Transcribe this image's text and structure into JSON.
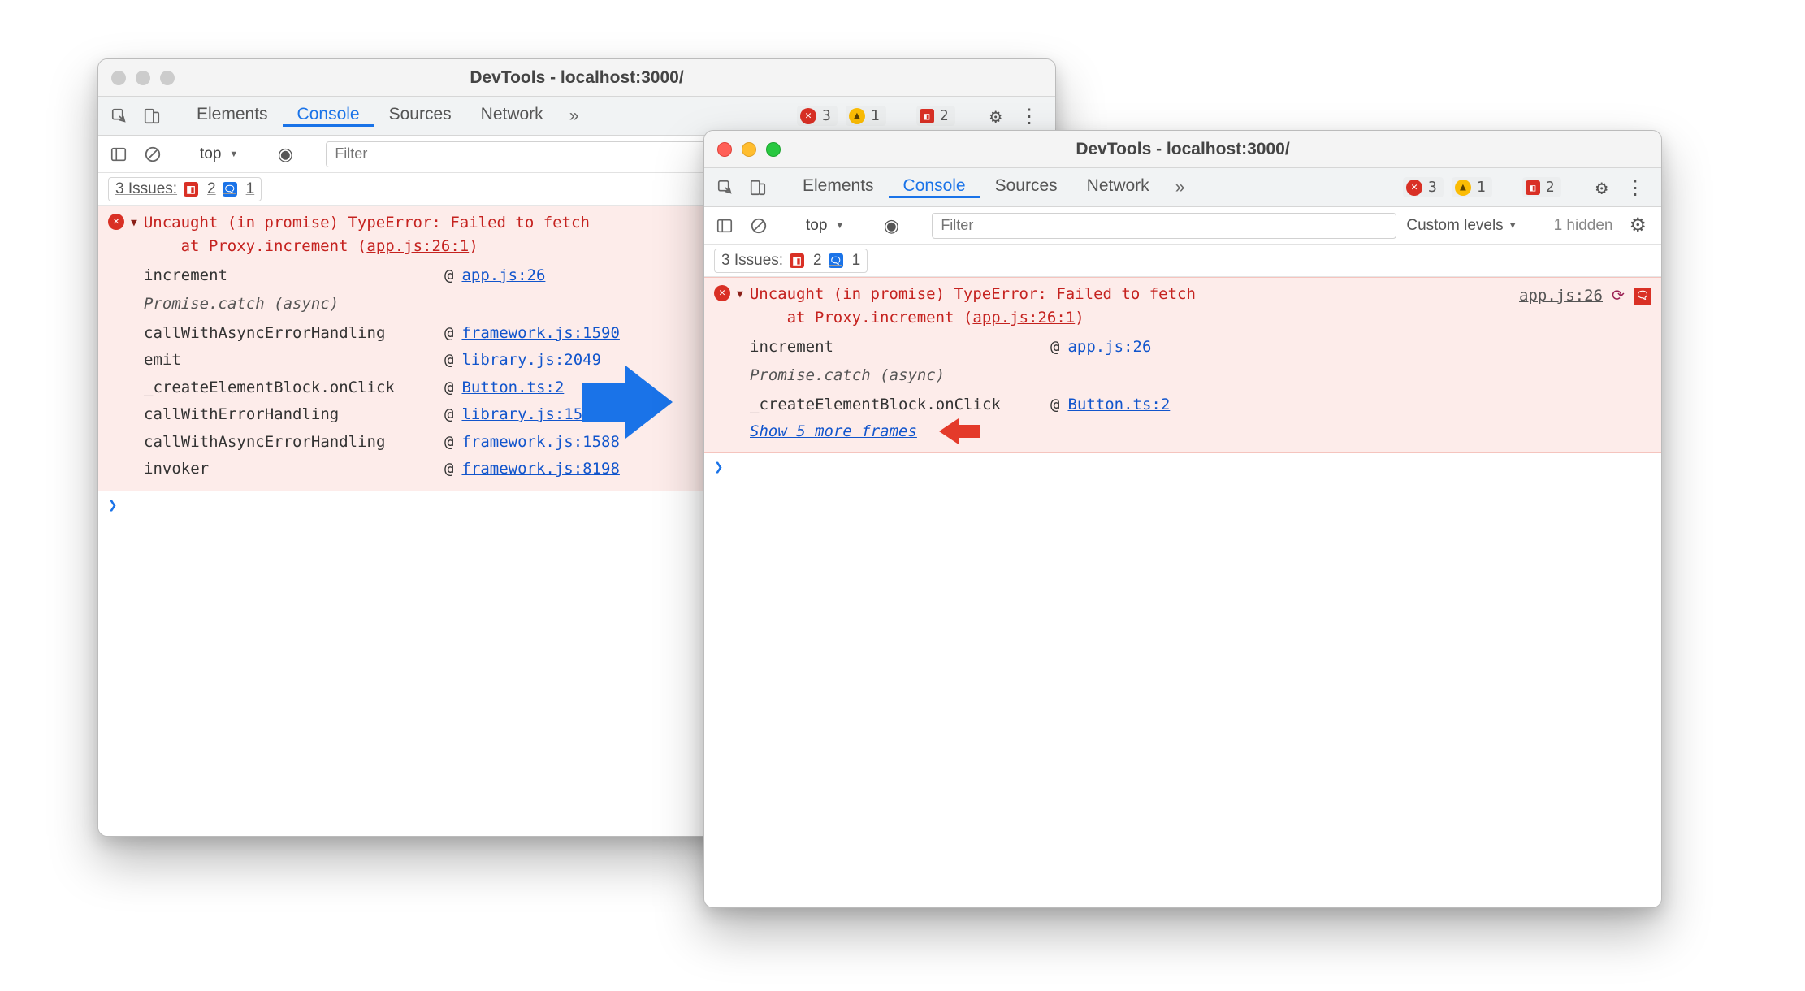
{
  "left": {
    "title": "DevTools - localhost:3000/",
    "tabs": [
      "Elements",
      "Console",
      "Sources",
      "Network"
    ],
    "activeTab": "Console",
    "badges": {
      "errors": "3",
      "warnings": "1",
      "sq_errors": "2"
    },
    "filter": {
      "placeholder": "Filter"
    },
    "top_label": "top",
    "issues": {
      "label": "3 Issues:",
      "sq": "2",
      "msg": "1"
    },
    "error": {
      "headline": "Uncaught (in promise) TypeError: Failed to fetch",
      "at_prefix": "at Proxy.increment (",
      "at_link": "app.js:26:1",
      "at_suffix": ")"
    },
    "stack": [
      {
        "fn": "increment",
        "at": "@",
        "link": "app.js:26"
      },
      {
        "sep": "Promise.catch (async)"
      },
      {
        "fn": "callWithAsyncErrorHandling",
        "at": "@",
        "link": "framework.js:1590"
      },
      {
        "fn": "emit",
        "at": "@",
        "link": "library.js:2049"
      },
      {
        "fn": "_createElementBlock.onClick",
        "at": "@",
        "link": "Button.ts:2"
      },
      {
        "fn": "callWithErrorHandling",
        "at": "@",
        "link": "library.js:1580"
      },
      {
        "fn": "callWithAsyncErrorHandling",
        "at": "@",
        "link": "framework.js:1588"
      },
      {
        "fn": "invoker",
        "at": "@",
        "link": "framework.js:8198"
      }
    ]
  },
  "right": {
    "title": "DevTools - localhost:3000/",
    "tabs": [
      "Elements",
      "Console",
      "Sources",
      "Network"
    ],
    "activeTab": "Console",
    "badges": {
      "errors": "3",
      "warnings": "1",
      "sq_errors": "2"
    },
    "filter": {
      "placeholder": "Filter"
    },
    "top_label": "top",
    "custom_levels": "Custom levels",
    "hidden": "1 hidden",
    "issues": {
      "label": "3 Issues:",
      "sq": "2",
      "msg": "1"
    },
    "error": {
      "headline": "Uncaught (in promise) TypeError: Failed to fetch",
      "at_prefix": "at Proxy.increment (",
      "at_link": "app.js:26:1",
      "at_suffix": ")",
      "source_link": "app.js:26"
    },
    "stack": [
      {
        "fn": "increment",
        "at": "@",
        "link": "app.js:26"
      },
      {
        "sep": "Promise.catch (async)"
      },
      {
        "fn": "_createElementBlock.onClick",
        "at": "@",
        "link": "Button.ts:2"
      }
    ],
    "show_more": "Show 5 more frames"
  },
  "prompt": "❯"
}
